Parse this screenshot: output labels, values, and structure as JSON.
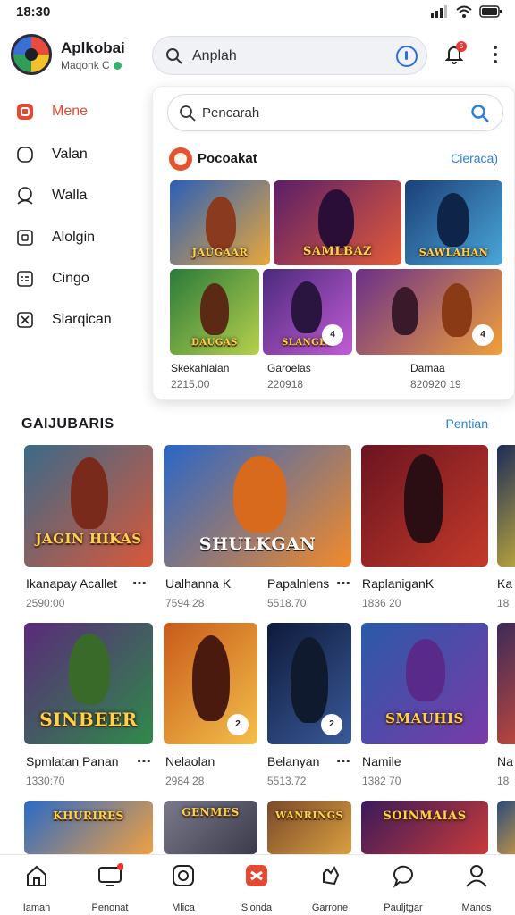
{
  "status_bar": {
    "time": "18:30"
  },
  "header": {
    "app_name": "Aplkobai",
    "app_sub": "Maqonk C",
    "search_placeholder": "Anplah",
    "notification_count": "5"
  },
  "sidebar": {
    "items": [
      {
        "label": "Mene",
        "icon": "home-icon",
        "active": true
      },
      {
        "label": "Valan",
        "icon": "tag-icon"
      },
      {
        "label": "Walla",
        "icon": "user-icon"
      },
      {
        "label": "Alolgin",
        "icon": "window-icon"
      },
      {
        "label": "Cingo",
        "icon": "list-icon"
      },
      {
        "label": "Slarqican",
        "icon": "close-box-icon"
      }
    ]
  },
  "dropdown": {
    "search_placeholder": "Pencarah",
    "title": "Pocoakat",
    "link": "Cieraca)",
    "tiles_top": [
      {
        "label": "JAUGAAR",
        "c1": "#2b5fb8",
        "c2": "#e9a73b"
      },
      {
        "label": "SAMLBAZ",
        "c1": "#5a1e68",
        "c2": "#e25b3a"
      },
      {
        "label": "SAWLAHAN",
        "c1": "#1b3f78",
        "c2": "#4aa7d9"
      }
    ],
    "tiles_bottom": [
      {
        "label": "DAUGAS",
        "c1": "#2a7a3a",
        "c2": "#b6d04c"
      },
      {
        "label": "SLANGES",
        "c1": "#4a2a7a",
        "c2": "#c25bd6",
        "badge": "4"
      },
      {
        "label": "",
        "c1": "#6a2f8a",
        "c2": "#f0a03a",
        "badge": "4"
      }
    ],
    "columns": [
      {
        "title": "Skekahlalan",
        "sub": "2215.00"
      },
      {
        "title": "Garoelas",
        "sub": "220918"
      },
      {
        "title": "Damaa",
        "sub": "820920 19"
      }
    ]
  },
  "section": {
    "title": "GAIJUBARIS",
    "link": "Pentian"
  },
  "cards_row1": [
    {
      "title": "Ikanapay Acallet",
      "sub": "2590:00",
      "label": "JAGIN HIKAS",
      "c1": "#3a6a8a",
      "c2": "#d9583a",
      "more": true
    },
    {
      "title": "Ualhanna K",
      "sub": "7594 28",
      "label": "SHULKGAN",
      "c1": "#2a66c8",
      "c2": "#f28a2a",
      "more": false
    },
    {
      "title": "Papalnlens",
      "sub": "5518.70",
      "label": "",
      "c1": "#6a1420",
      "c2": "#c43a2a",
      "more": true
    },
    {
      "title": "RaplaniganK",
      "sub": "1836 20",
      "label": "",
      "c1": "#1c2a5a",
      "c2": "#c8b03a",
      "more": false
    },
    {
      "title": "Ka",
      "sub": "18",
      "label": "",
      "c1": "#2a3a6a",
      "c2": "#d9a33a",
      "more": false
    }
  ],
  "cards_row2": [
    {
      "title": "Spmlatan Panan",
      "sub": "1330:70",
      "label": "SINBEER",
      "c1": "#5a2a7a",
      "c2": "#2f8a4a",
      "more": true
    },
    {
      "title": "Nelaolan",
      "sub": "2984 28",
      "label": "",
      "c1": "#c85a1a",
      "c2": "#f3c04a",
      "badge": "2",
      "more": false
    },
    {
      "title": "Belanyan",
      "sub": "5513.72",
      "label": "",
      "c1": "#0e1a3a",
      "c2": "#3a5a9a",
      "badge": "2",
      "more": true
    },
    {
      "title": "Namile",
      "sub": "1382 70",
      "label": "SMAUHIS",
      "c1": "#2a5aa8",
      "c2": "#7a3aa8",
      "more": false
    },
    {
      "title": "Na",
      "sub": "18",
      "label": "",
      "c1": "#3a2a5a",
      "c2": "#c84a3a",
      "more": false
    }
  ],
  "cards_row3": [
    {
      "label": "KHURIRES",
      "c1": "#2a6ac8",
      "c2": "#f0a040"
    },
    {
      "label": "GENMES",
      "c1": "#7a7a8a",
      "c2": "#3a3a4a"
    },
    {
      "label": "WANRINGS",
      "c1": "#7a4a2a",
      "c2": "#d9a040"
    },
    {
      "label": "SOINMAIAS",
      "c1": "#3a1a5a",
      "c2": "#c83a3a"
    },
    {
      "label": "",
      "c1": "#2a4a7a",
      "c2": "#d9a040"
    }
  ],
  "bottom_nav": [
    {
      "label": "Iaman",
      "icon": "home-icon"
    },
    {
      "label": "Penonat",
      "icon": "monitor-icon",
      "dot": true
    },
    {
      "label": "Mlica",
      "icon": "camera-icon"
    },
    {
      "label": "Slonda",
      "icon": "close-tile-icon",
      "active": true
    },
    {
      "label": "Garrone",
      "icon": "hand-icon"
    },
    {
      "label": "Pauljtgar",
      "icon": "chat-icon"
    },
    {
      "label": "Manos",
      "icon": "person-icon"
    }
  ],
  "colors": {
    "accent": "#e44a33",
    "link": "#2a7fd6",
    "search_bg": "#f1f2f6"
  }
}
